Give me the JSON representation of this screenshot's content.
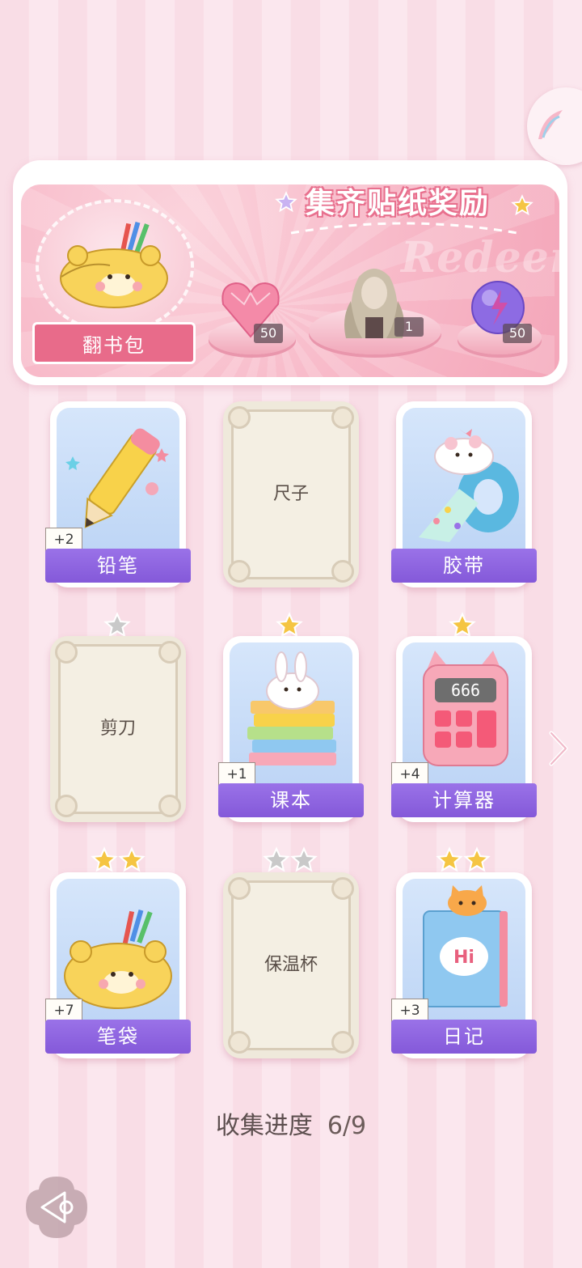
{
  "banner": {
    "title": "集齐贴纸奖励",
    "watermark": "Redeem",
    "badge_label": "翻书包",
    "rewards": [
      {
        "name": "pink-diamond-heart",
        "count": "50"
      },
      {
        "name": "hairstyle-outfit",
        "count": "1"
      },
      {
        "name": "purple-energy-orb",
        "count": "50"
      }
    ]
  },
  "cards": [
    {
      "name": "铅笔",
      "unlocked": true,
      "stars": 0,
      "bonus": "+2"
    },
    {
      "name": "尺子",
      "unlocked": false,
      "stars": 0,
      "bonus": ""
    },
    {
      "name": "胶带",
      "unlocked": true,
      "stars": 0,
      "bonus": ""
    },
    {
      "name": "剪刀",
      "unlocked": false,
      "stars": 1,
      "bonus": ""
    },
    {
      "name": "课本",
      "unlocked": true,
      "stars": 1,
      "bonus": "+1"
    },
    {
      "name": "计算器",
      "unlocked": true,
      "stars": 1,
      "bonus": "+4"
    },
    {
      "name": "笔袋",
      "unlocked": true,
      "stars": 2,
      "bonus": "+7"
    },
    {
      "name": "保温杯",
      "unlocked": false,
      "stars": 2,
      "bonus": ""
    },
    {
      "name": "日记",
      "unlocked": true,
      "stars": 2,
      "bonus": "+3"
    }
  ],
  "calculator_display": "666",
  "diary_cover_text": "Hi",
  "progress": {
    "label": "收集进度",
    "value": "6/9"
  },
  "colors": {
    "accent_purple": "#8459d9",
    "pink": "#e86b8a",
    "star_gold": "#f5c542",
    "star_gray": "#c9c9c9"
  }
}
